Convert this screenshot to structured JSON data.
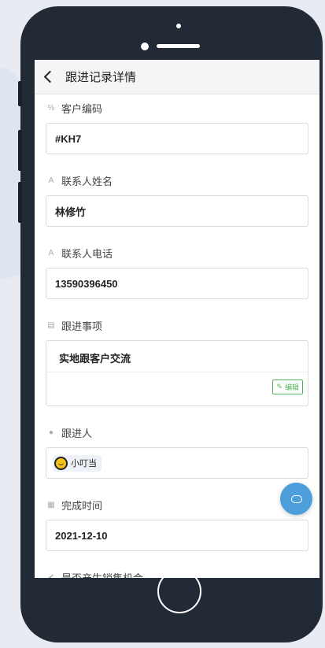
{
  "header": {
    "title": "跟进记录详情"
  },
  "fields": {
    "customer_code": {
      "label": "客户编码",
      "value": "#KH7",
      "icon": "link-icon"
    },
    "contact_name": {
      "label": "联系人姓名",
      "value": "林修竹",
      "icon": "text-icon"
    },
    "contact_phone": {
      "label": "联系人电话",
      "value": "13590396450",
      "icon": "text-icon"
    },
    "follow_up_item": {
      "label": "跟进事项",
      "value": "实地跟客户交流",
      "edit_label": "编辑",
      "icon": "document-icon"
    },
    "follower": {
      "label": "跟进人",
      "user": "小叮当",
      "icon": "person-icon"
    },
    "completion_time": {
      "label": "完成时间",
      "value": "2021-12-10",
      "icon": "calendar-icon"
    },
    "sales_opportunity": {
      "label": "是否产生销售机会",
      "icon": "check-circle-icon"
    }
  },
  "colors": {
    "accent_green": "#52b35a",
    "float_button": "#4d9fdb",
    "phone_frame": "#222a35"
  }
}
